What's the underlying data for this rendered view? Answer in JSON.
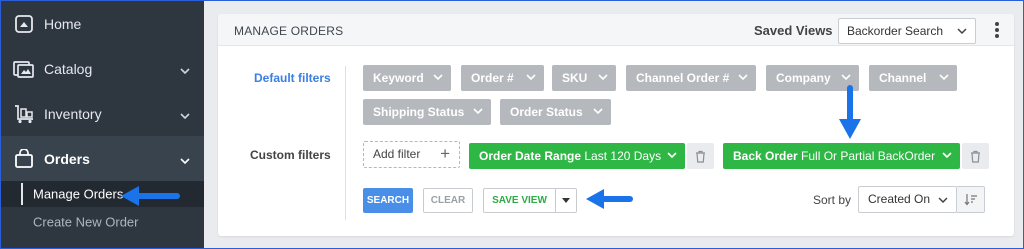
{
  "sidebar": {
    "items": [
      {
        "label": "Home",
        "icon": "home-icon"
      },
      {
        "label": "Catalog",
        "icon": "catalog-icon"
      },
      {
        "label": "Inventory",
        "icon": "inventory-icon"
      },
      {
        "label": "Orders",
        "icon": "orders-icon"
      }
    ],
    "sub_items": [
      {
        "label": "Manage Orders"
      },
      {
        "label": "Create New Order"
      }
    ]
  },
  "panel": {
    "title": "MANAGE ORDERS",
    "saved_views_label": "Saved Views",
    "saved_view_selected": "Backorder Search"
  },
  "filters": {
    "default_label": "Default filters",
    "default_chips": [
      "Keyword",
      "Order #",
      "SKU",
      "Channel Order #",
      "Company",
      "Channel",
      "Shipping Status",
      "Order Status"
    ],
    "custom_label": "Custom filters",
    "add_filter_label": "Add filter",
    "custom": [
      {
        "name": "Order Date Range",
        "value": "Last 120 Days"
      },
      {
        "name": "Back Order",
        "value": "Full Or Partial BackOrder"
      }
    ]
  },
  "actions": {
    "search_label": "SEARCH",
    "clear_label": "CLEAR",
    "save_view_label": "SAVE VIEW"
  },
  "sort": {
    "label": "Sort by",
    "selected": "Created On"
  },
  "colors": {
    "sidebar_bg": "#2e3640",
    "accent_blue": "#4a8fe7",
    "filter_green": "#2fb746",
    "chip_gray": "#b5b8bc",
    "annotation_arrow": "#1a73e8"
  }
}
